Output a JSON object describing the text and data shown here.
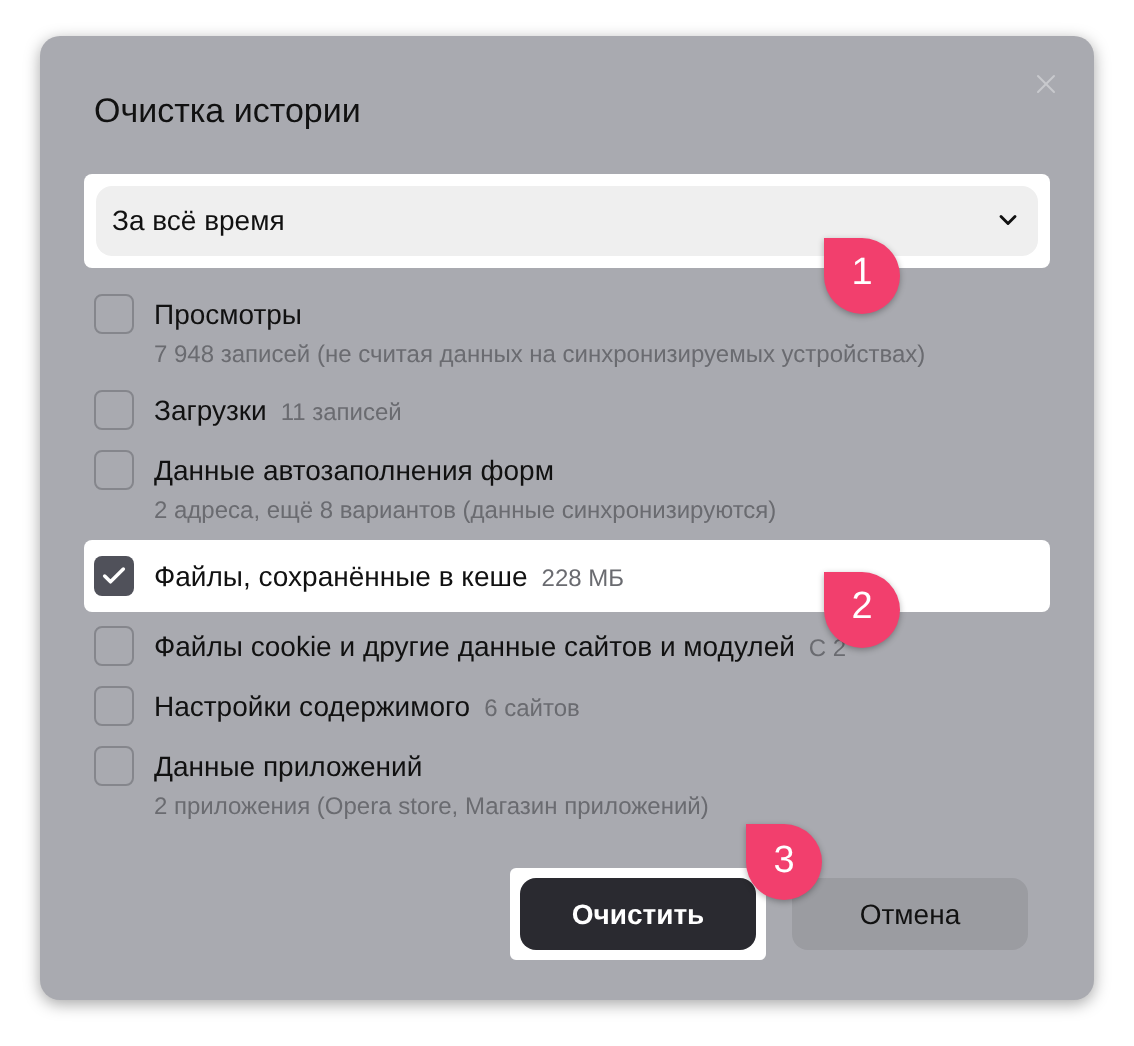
{
  "dialog": {
    "title": "Очистка истории"
  },
  "period": {
    "value": "За всё время",
    "highlighted": true,
    "badge": "1"
  },
  "items": [
    {
      "label": "Просмотры",
      "detail": "7 948 записей (не считая данных на синхронизируемых устройствах)",
      "kind": "stacked",
      "checked": false,
      "highlighted": false
    },
    {
      "label": "Загрузки",
      "detail": "11 записей",
      "kind": "inline",
      "checked": false,
      "highlighted": false
    },
    {
      "label": "Данные автозаполнения форм",
      "detail": "2 адреса, ещё 8 вариантов (данные синхронизируются)",
      "kind": "stacked",
      "checked": false,
      "highlighted": false
    },
    {
      "label": "Файлы, сохранённые в кеше",
      "detail": "228 МБ",
      "kind": "inline",
      "checked": true,
      "highlighted": true,
      "badge": "2"
    },
    {
      "label": "Файлы cookie и другие данные сайтов и модулей",
      "detail": "С 2",
      "kind": "inline",
      "checked": false,
      "highlighted": false
    },
    {
      "label": "Настройки содержимого",
      "detail": "6 сайтов",
      "kind": "inline",
      "checked": false,
      "highlighted": false
    },
    {
      "label": "Данные приложений",
      "detail": "2 приложения (Opera store, Магазин приложений)",
      "kind": "stacked",
      "checked": false,
      "highlighted": false
    }
  ],
  "buttons": [
    {
      "label": "Очистить",
      "kind": "primary",
      "highlighted": true,
      "badge": "3"
    },
    {
      "label": "Отмена",
      "kind": "secondary",
      "highlighted": false
    }
  ]
}
